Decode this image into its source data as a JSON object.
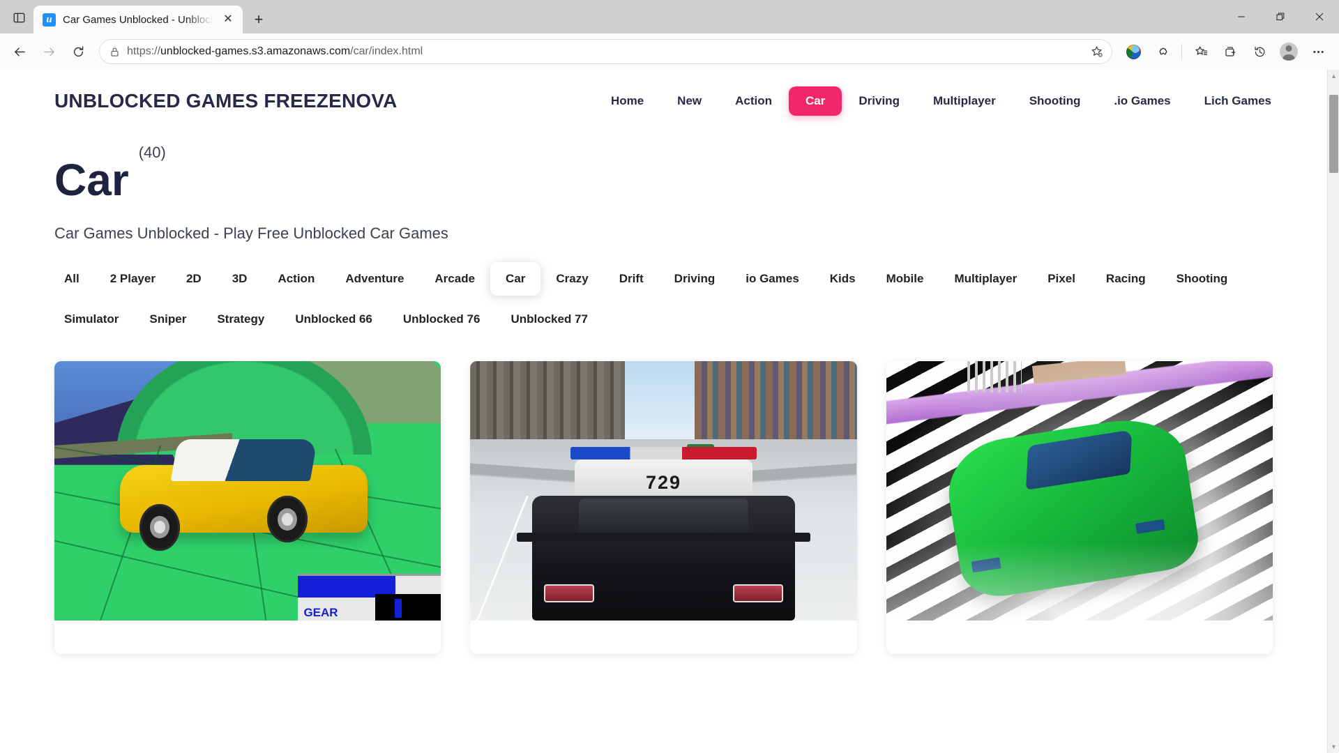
{
  "browser": {
    "tab_search_icon": "tab-search-icon",
    "tab": {
      "favicon_letter": "u",
      "title": "Car Games Unblocked - Unblock",
      "close_label": "✕"
    },
    "new_tab_label": "+",
    "window_controls": {
      "minimize": "minimize-icon",
      "restore": "restore-icon",
      "close": "close-icon"
    },
    "nav": {
      "back": "back-arrow-icon",
      "forward": "forward-arrow-icon",
      "refresh": "refresh-icon"
    },
    "address": {
      "lock_icon": "lock-icon",
      "url_prefix": "https://",
      "url_host": "unblocked-games.s3.amazonaws.com",
      "url_path": "/car/index.html",
      "full_url": "https://unblocked-games.s3.amazonaws.com/car/index.html",
      "favorite_icon": "add-favorite-star-icon"
    },
    "toolbar_icons": [
      {
        "name": "idm-extension-icon",
        "label": "IDM"
      },
      {
        "name": "extensions-puzzle-icon",
        "label": "Extensions"
      },
      {
        "name": "favorites-star-icon",
        "label": "Favorites"
      },
      {
        "name": "collections-icon",
        "label": "Collections"
      },
      {
        "name": "history-icon",
        "label": "History"
      },
      {
        "name": "profile-avatar-icon",
        "label": "Profile"
      },
      {
        "name": "settings-ellipsis-icon",
        "label": "Settings and more"
      }
    ],
    "scrollbar": {
      "up_arrow": "▲",
      "down_arrow": "▼"
    }
  },
  "site": {
    "logo": "UNBLOCKED GAMES FREEZENOVA",
    "nav": [
      {
        "label": "Home",
        "active": false
      },
      {
        "label": "New",
        "active": false
      },
      {
        "label": "Action",
        "active": false
      },
      {
        "label": "Car",
        "active": true
      },
      {
        "label": "Driving",
        "active": false
      },
      {
        "label": "Multiplayer",
        "active": false
      },
      {
        "label": "Shooting",
        "active": false
      },
      {
        "label": ".io Games",
        "active": false
      },
      {
        "label": "Lich Games",
        "active": false
      }
    ],
    "accent_color": "#f2276b",
    "heading_color": "#1e2440"
  },
  "page": {
    "title": "Car",
    "count": "(40)",
    "subtitle": "Car Games Unblocked - Play Free Unblocked Car Games",
    "filters": [
      {
        "label": "All",
        "active": false
      },
      {
        "label": "2 Player",
        "active": false
      },
      {
        "label": "2D",
        "active": false
      },
      {
        "label": "3D",
        "active": false
      },
      {
        "label": "Action",
        "active": false
      },
      {
        "label": "Adventure",
        "active": false
      },
      {
        "label": "Arcade",
        "active": false
      },
      {
        "label": "Car",
        "active": true
      },
      {
        "label": "Crazy",
        "active": false
      },
      {
        "label": "Drift",
        "active": false
      },
      {
        "label": "Driving",
        "active": false
      },
      {
        "label": "io Games",
        "active": false
      },
      {
        "label": "Kids",
        "active": false
      },
      {
        "label": "Mobile",
        "active": false
      },
      {
        "label": "Multiplayer",
        "active": false
      },
      {
        "label": "Pixel",
        "active": false
      },
      {
        "label": "Racing",
        "active": false
      },
      {
        "label": "Shooting",
        "active": false
      },
      {
        "label": "Simulator",
        "active": false
      },
      {
        "label": "Sniper",
        "active": false
      },
      {
        "label": "Strategy",
        "active": false
      },
      {
        "label": "Unblocked 66",
        "active": false
      },
      {
        "label": "Unblocked 76",
        "active": false
      },
      {
        "label": "Unblocked 77",
        "active": false
      }
    ],
    "cards": [
      {
        "thumb": "yellow-sports-car-green-terrain",
        "hud_label": "GEAR"
      },
      {
        "thumb": "police-car-city-highway",
        "car_number": "729"
      },
      {
        "thumb": "green-car-striped-track"
      }
    ]
  }
}
